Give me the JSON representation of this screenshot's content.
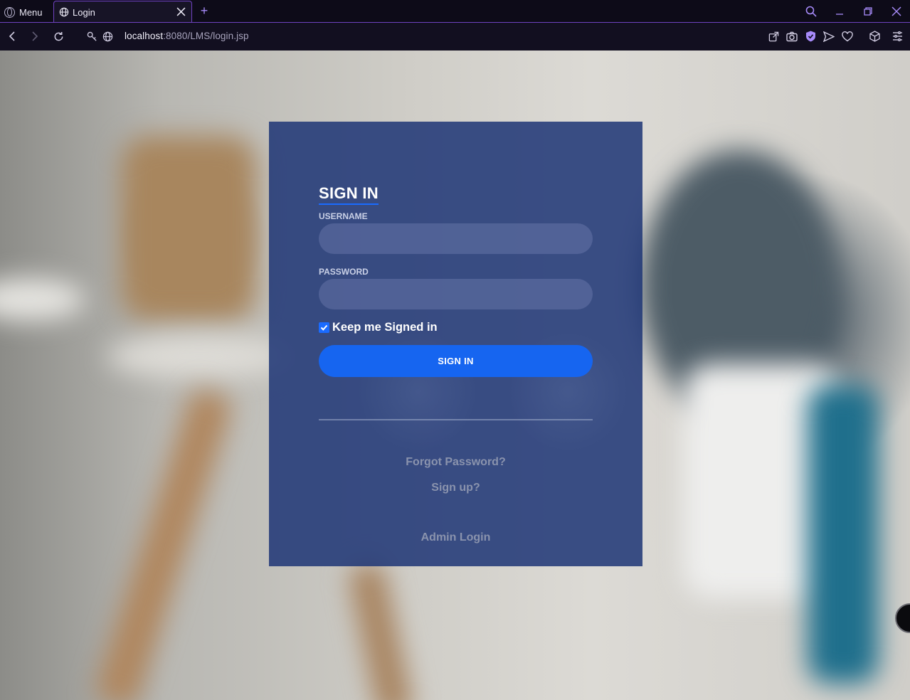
{
  "browser": {
    "menu_label": "Menu",
    "tab_title": "Login",
    "url_host": "localhost",
    "url_rest": ":8080/LMS/login.jsp",
    "accent": "#6f42c1"
  },
  "login": {
    "title": "SIGN IN",
    "username_label": "USERNAME",
    "username_value": "",
    "password_label": "PASSWORD",
    "password_value": "",
    "remember_label": "Keep me Signed in",
    "remember_checked": true,
    "submit_label": "SIGN IN",
    "forgot_link": "Forgot Password?",
    "signup_link": "Sign up?",
    "admin_link": "Admin Login",
    "button_color": "#1665f0",
    "card_color": "#1e3676"
  }
}
